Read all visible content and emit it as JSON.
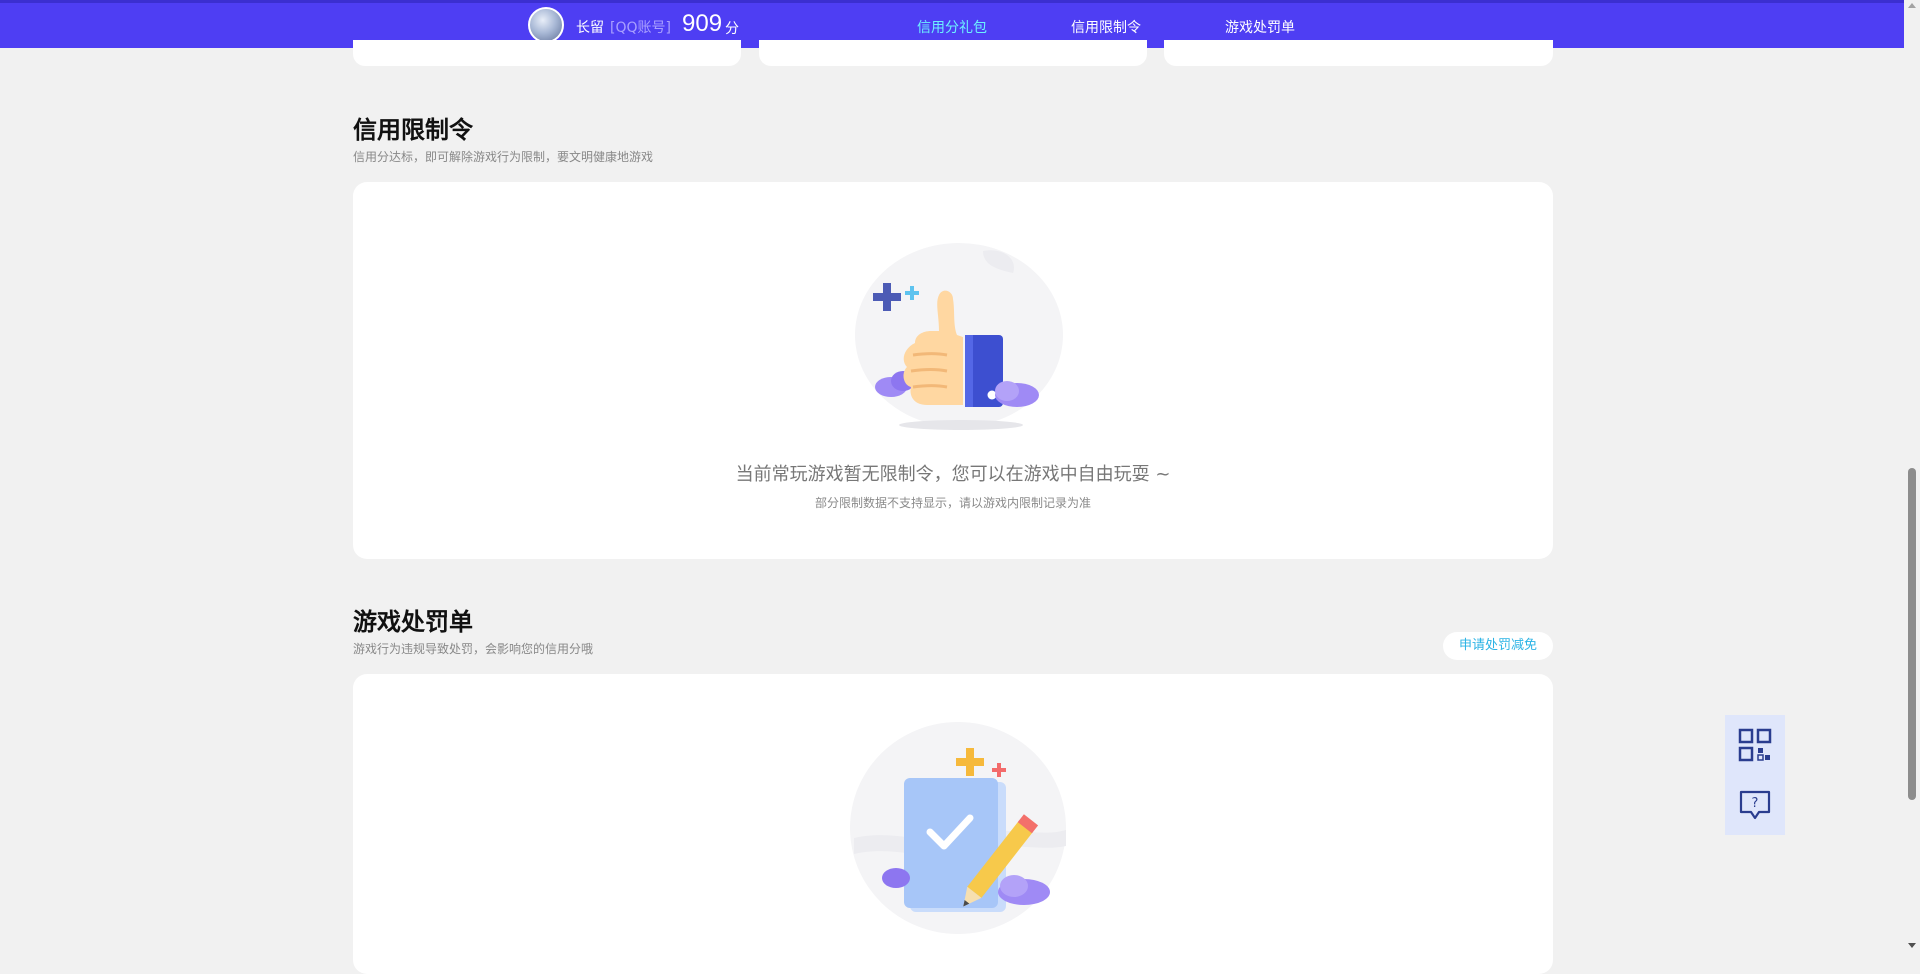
{
  "header": {
    "username": "长留",
    "account_type": "[QQ账号]",
    "score": "909",
    "score_unit": "分",
    "nav": [
      {
        "label": "信用分礼包",
        "active": true
      },
      {
        "label": "信用限制令",
        "active": false
      },
      {
        "label": "游戏处罚单",
        "active": false
      }
    ]
  },
  "restriction": {
    "title": "信用限制令",
    "subtitle": "信用分达标，即可解除游戏行为限制，要文明健康地游戏",
    "empty_message": "当前常玩游戏暂无限制令，您可以在游戏中自由玩耍 ~",
    "empty_note": "部分限制数据不支持显示，请以游戏内限制记录为准",
    "illustration_icon": "thumbs-up-icon"
  },
  "penalty": {
    "title": "游戏处罚单",
    "subtitle": "游戏行为违规导致处罚，会影响您的信用分哦",
    "appeal_label": "申请处罚减免",
    "illustration_icon": "checklist-pencil-icon"
  },
  "float_tools": [
    {
      "icon": "qr-code-icon"
    },
    {
      "icon": "help-chat-icon"
    }
  ],
  "colors": {
    "topbar": "#4e3ef3",
    "nav_active": "#6cf0ff",
    "accent_blue": "#2bb3e5",
    "background": "#f1f1f1"
  }
}
